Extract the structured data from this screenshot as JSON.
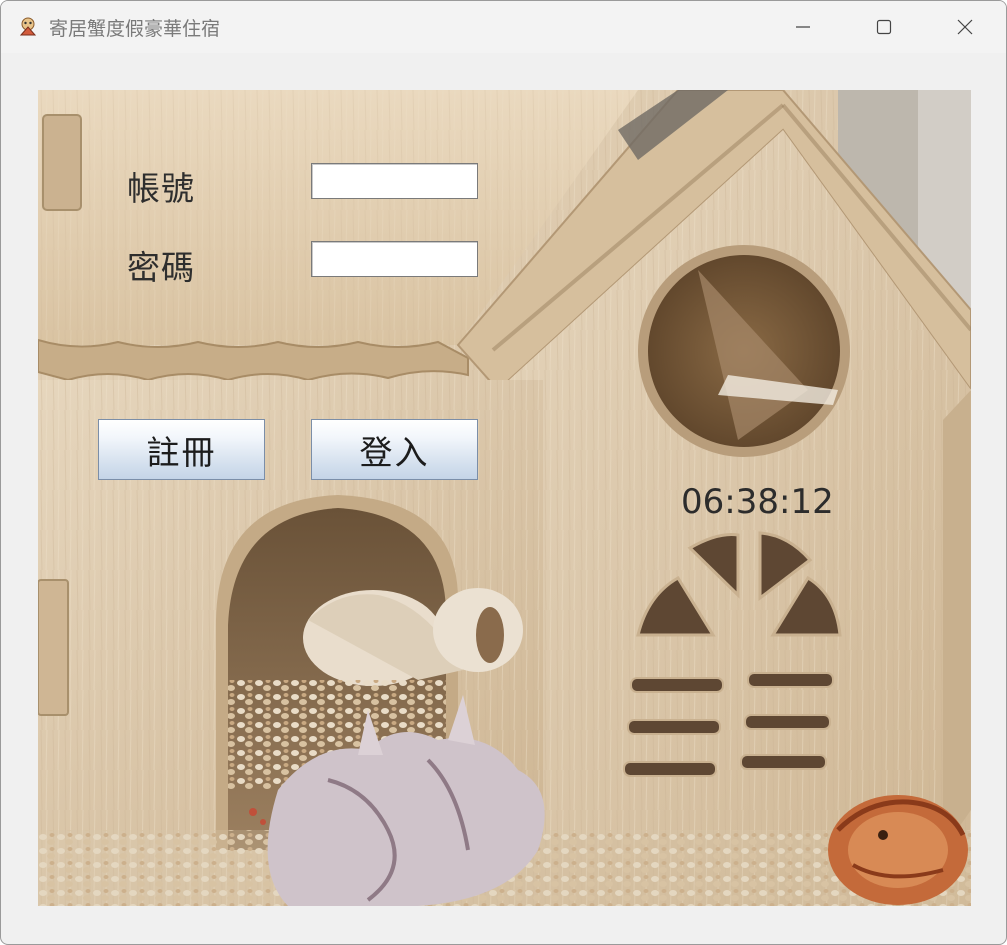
{
  "window": {
    "title": "寄居蟹度假豪華住宿",
    "controls": {
      "minimize_icon": "minimize-icon",
      "maximize_icon": "maximize-icon",
      "close_icon": "close-icon"
    }
  },
  "form": {
    "account_label": "帳號",
    "account_value": "",
    "password_label": "密碼",
    "password_value": "",
    "register_button": "註冊",
    "login_button": "登入"
  },
  "clock": {
    "time": "06:38:12"
  },
  "background": {
    "description_icon": "hermit-crab-house-photo"
  },
  "colors": {
    "window_bg": "#f0f0f0",
    "button_gradient_top": "#ffffff",
    "button_gradient_bottom": "#c4d4e7",
    "wood": "#dccab0"
  }
}
